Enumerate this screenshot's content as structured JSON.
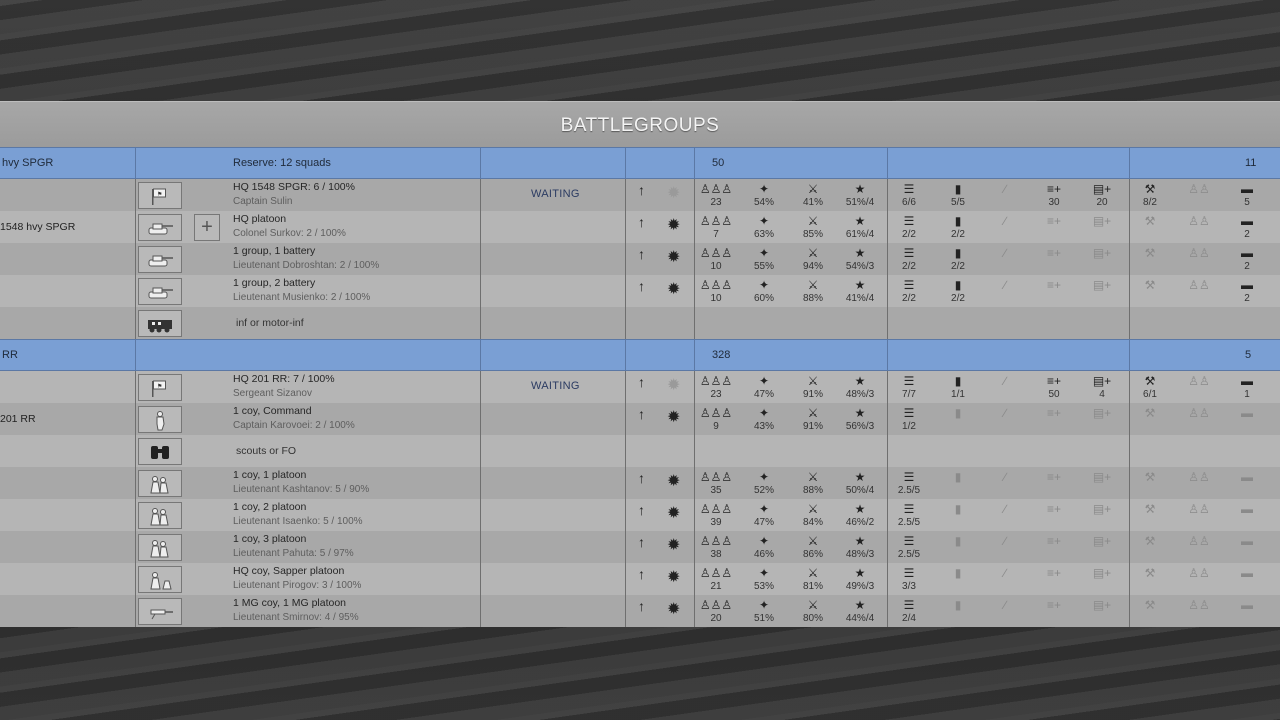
{
  "title": "BATTLEGROUPS",
  "groups": [
    {
      "name": "hvy SPGR",
      "reserve_label": "Reserve: 12  squads",
      "count_a": "50",
      "count_b": "11",
      "rows": [
        {
          "left": "",
          "line1": "HQ 1548 SPGR: 6 / 100%",
          "line2": "Captain Sulin",
          "status": "WAITING",
          "icon": "hq-flag-icon",
          "men": "23",
          "morale": "54%",
          "fatigue": "41%",
          "exp": "51%/4",
          "s1": "6/6",
          "s2": "5/5",
          "s3": "",
          "s4": "30",
          "s5": "20",
          "s6": "8/2",
          "s7": "",
          "s8": "5"
        },
        {
          "left": "1548 hvy SPGR",
          "line1": "HQ platoon",
          "line2": "Colonel Surkov: 2 / 100%",
          "status": "",
          "icon": "spg-icon",
          "plus": true,
          "men": "7",
          "morale": "63%",
          "fatigue": "85%",
          "exp": "61%/4",
          "s1": "2/2",
          "s2": "2/2",
          "s3": "",
          "s4": "",
          "s5": "",
          "s6": "",
          "s7": "",
          "s8": "2"
        },
        {
          "left": "",
          "line1": "1 group, 1 battery",
          "line2": "Lieutenant Dobroshtan: 2 / 100%",
          "status": "",
          "icon": "spg-icon",
          "men": "10",
          "morale": "55%",
          "fatigue": "94%",
          "exp": "54%/3",
          "s1": "2/2",
          "s2": "2/2",
          "s3": "",
          "s4": "",
          "s5": "",
          "s6": "",
          "s7": "",
          "s8": "2"
        },
        {
          "left": "",
          "line1": "1 group, 2 battery",
          "line2": "Lieutenant Musienko: 2 / 100%",
          "status": "",
          "icon": "spg-icon",
          "men": "10",
          "morale": "60%",
          "fatigue": "88%",
          "exp": "41%/4",
          "s1": "2/2",
          "s2": "2/2",
          "s3": "",
          "s4": "",
          "s5": "",
          "s6": "",
          "s7": "",
          "s8": "2"
        },
        {
          "left": "",
          "mid": "inf or motor-inf",
          "icon": "halftrack-icon",
          "empty": true
        }
      ]
    },
    {
      "name": "RR",
      "reserve_label": "",
      "count_a": "328",
      "count_b": "5",
      "rows": [
        {
          "left": "",
          "line1": "HQ 201 RR: 7 / 100%",
          "line2": "Sergeant Sizanov",
          "status": "WAITING",
          "icon": "hq-flag-icon",
          "men": "23",
          "morale": "47%",
          "fatigue": "91%",
          "exp": "48%/3",
          "s1": "7/7",
          "s2": "1/1",
          "s3": "",
          "s4": "50",
          "s5": "4",
          "s6": "6/1",
          "s7": "",
          "s8": "1"
        },
        {
          "left": "201 RR",
          "line1": "1 coy, Command",
          "line2": "Captain Karovoei: 2 / 100%",
          "status": "",
          "icon": "officer-icon",
          "men": "9",
          "morale": "43%",
          "fatigue": "91%",
          "exp": "56%/3",
          "s1": "1/2",
          "s2": "",
          "s3": "",
          "s4": "",
          "s5": "",
          "s6": "",
          "s7": "",
          "s8": ""
        },
        {
          "left": "",
          "mid": "scouts or FO",
          "icon": "binoculars-icon",
          "empty": true
        },
        {
          "left": "",
          "line1": "1 coy, 1 platoon",
          "line2": "Lieutenant Kashtanov: 5 / 90%",
          "status": "",
          "icon": "infantry-icon",
          "men": "35",
          "morale": "52%",
          "fatigue": "88%",
          "exp": "50%/4",
          "s1": "2.5/5",
          "s2": "",
          "s3": "",
          "s4": "",
          "s5": "",
          "s6": "",
          "s7": "",
          "s8": ""
        },
        {
          "left": "",
          "line1": "1 coy, 2 platoon",
          "line2": "Lieutenant Isaenko: 5 / 100%",
          "status": "",
          "icon": "infantry-icon",
          "men": "39",
          "morale": "47%",
          "fatigue": "84%",
          "exp": "46%/2",
          "s1": "2.5/5",
          "s2": "",
          "s3": "",
          "s4": "",
          "s5": "",
          "s6": "",
          "s7": "",
          "s8": ""
        },
        {
          "left": "",
          "line1": "1 coy, 3 platoon",
          "line2": "Lieutenant Pahuta: 5 / 97%",
          "status": "",
          "icon": "infantry-icon",
          "men": "38",
          "morale": "46%",
          "fatigue": "86%",
          "exp": "48%/3",
          "s1": "2.5/5",
          "s2": "",
          "s3": "",
          "s4": "",
          "s5": "",
          "s6": "",
          "s7": "",
          "s8": ""
        },
        {
          "left": "",
          "line1": "HQ coy, Sapper platoon",
          "line2": "Lieutenant Pirogov: 3 / 100%",
          "status": "",
          "icon": "sapper-icon",
          "men": "21",
          "morale": "53%",
          "fatigue": "81%",
          "exp": "49%/3",
          "s1": "3/3",
          "s2": "",
          "s3": "",
          "s4": "",
          "s5": "",
          "s6": "",
          "s7": "",
          "s8": ""
        },
        {
          "left": "",
          "line1": "1 MG coy, 1 MG platoon",
          "line2": "Lieutenant Smirnov: 4 / 95%",
          "status": "",
          "icon": "mg-icon",
          "men": "20",
          "morale": "51%",
          "fatigue": "80%",
          "exp": "44%/4",
          "s1": "2/4",
          "s2": "",
          "s3": "",
          "s4": "",
          "s5": "",
          "s6": "",
          "s7": "",
          "s8": ""
        }
      ]
    }
  ],
  "icons": {
    "men": "men-icon",
    "morale": "eagle-icon",
    "fatigue": "runner-icon",
    "exp": "star-icon",
    "s1": "list-icon",
    "s2": "ammo-icon",
    "s3": "rifle-icon",
    "s4": "list-plus-icon",
    "s5": "doc-plus-icon",
    "s6": "tools-icon",
    "s7": "crew-icon",
    "s8": "truck-icon"
  }
}
